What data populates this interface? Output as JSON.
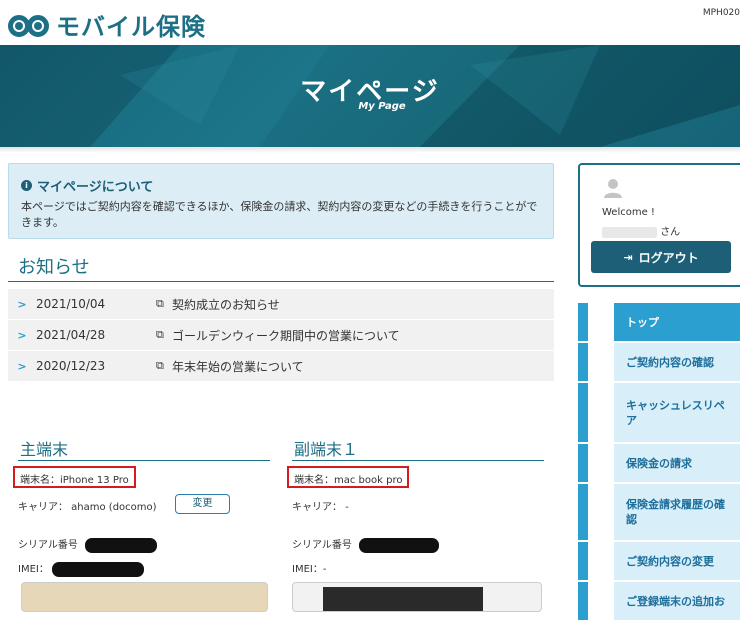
{
  "header": {
    "logo_text": "モバイル保険",
    "page_code": "MPH020"
  },
  "banner": {
    "title": "マイページ",
    "subtitle": "My Page"
  },
  "info": {
    "icon": "info-icon",
    "title": "マイページについて",
    "body": "本ページではご契約内容を確認できるほか、保険金の請求、契約内容の変更などの手続きを行うことができます。"
  },
  "news": {
    "heading": "お知らせ",
    "items": [
      {
        "date": "2021/10/04",
        "title": "契約成立のお知らせ"
      },
      {
        "date": "2021/04/28",
        "title": "ゴールデンウィーク期間中の営業について"
      },
      {
        "date": "2020/12/23",
        "title": "年末年始の営業について"
      }
    ]
  },
  "main_device": {
    "heading": "主端末",
    "name": "端末名：iPhone 13 Pro",
    "carrier": "キャリア： ahamo (docomo)",
    "change_label": "変更",
    "serial_label": "シリアル番号",
    "imei_label": "IMEI："
  },
  "sub_device": {
    "heading": "副端末１",
    "name": "端末名：mac book pro",
    "carrier": "キャリア： -",
    "serial_label": "シリアル番号",
    "imei_label": "IMEI：-"
  },
  "user_panel": {
    "welcome": "Welcome !",
    "name_suffix": "さん",
    "logout_label": "ログアウト"
  },
  "sidenav": {
    "items": [
      {
        "label": "トップ"
      },
      {
        "label": "ご契約内容の確認"
      },
      {
        "label": "キャッシュレスリペア"
      },
      {
        "label": "保険金の請求"
      },
      {
        "label": "保険金請求履歴の確認"
      },
      {
        "label": "ご契約内容の変更"
      },
      {
        "label": "ご登録端末の追加お"
      }
    ]
  },
  "colors": {
    "brand": "#1d6f86",
    "accent": "#2a9fd0",
    "highlight_border": "#d71920"
  }
}
